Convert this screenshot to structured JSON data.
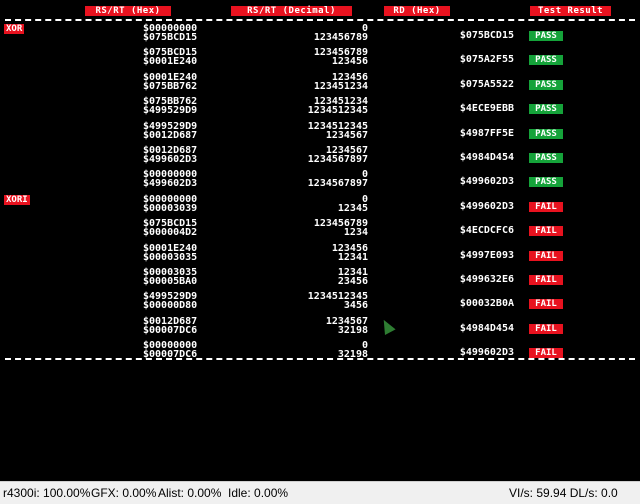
{
  "headers": {
    "rs_rt_hex": "RS/RT (Hex)",
    "rs_rt_dec": "RS/RT (Decimal)",
    "rd_hex": "RD (Hex)",
    "result": "Test Result"
  },
  "sections": [
    {
      "name": "XOR",
      "rows": [
        {
          "hex1": "$00000000",
          "hex2": "$075BCD15",
          "dec1": "0",
          "dec2": "123456789",
          "rd": "$075BCD15",
          "result": "PASS"
        },
        {
          "hex1": "$075BCD15",
          "hex2": "$0001E240",
          "dec1": "123456789",
          "dec2": "123456",
          "rd": "$075A2F55",
          "result": "PASS"
        },
        {
          "hex1": "$0001E240",
          "hex2": "$075BB762",
          "dec1": "123456",
          "dec2": "123451234",
          "rd": "$075A5522",
          "result": "PASS"
        },
        {
          "hex1": "$075BB762",
          "hex2": "$499529D9",
          "dec1": "123451234",
          "dec2": "1234512345",
          "rd": "$4ECE9EBB",
          "result": "PASS"
        },
        {
          "hex1": "$499529D9",
          "hex2": "$0012D687",
          "dec1": "1234512345",
          "dec2": "1234567",
          "rd": "$4987FF5E",
          "result": "PASS"
        },
        {
          "hex1": "$0012D687",
          "hex2": "$499602D3",
          "dec1": "1234567",
          "dec2": "1234567897",
          "rd": "$4984D454",
          "result": "PASS"
        },
        {
          "hex1": "$00000000",
          "hex2": "$499602D3",
          "dec1": "0",
          "dec2": "1234567897",
          "rd": "$499602D3",
          "result": "PASS"
        }
      ]
    },
    {
      "name": "XORI",
      "rows": [
        {
          "hex1": "$00000000",
          "hex2": "$00003039",
          "dec1": "0",
          "dec2": "12345",
          "rd": "$499602D3",
          "result": "FAIL"
        },
        {
          "hex1": "$075BCD15",
          "hex2": "$000004D2",
          "dec1": "123456789",
          "dec2": "1234",
          "rd": "$4ECDCFC6",
          "result": "FAIL"
        },
        {
          "hex1": "$0001E240",
          "hex2": "$00003035",
          "dec1": "123456",
          "dec2": "12341",
          "rd": "$4997E093",
          "result": "FAIL"
        },
        {
          "hex1": "$00003035",
          "hex2": "$00005BA0",
          "dec1": "12341",
          "dec2": "23456",
          "rd": "$499632E6",
          "result": "FAIL"
        },
        {
          "hex1": "$499529D9",
          "hex2": "$00000D80",
          "dec1": "1234512345",
          "dec2": "3456",
          "rd": "$00032B0A",
          "result": "FAIL"
        },
        {
          "hex1": "$0012D687",
          "hex2": "$00007DC6",
          "dec1": "1234567",
          "dec2": "32198",
          "rd": "$4984D454",
          "result": "FAIL"
        },
        {
          "hex1": "$00000000",
          "hex2": "$00007DC6",
          "dec1": "0",
          "dec2": "32198",
          "rd": "$499602D3",
          "result": "FAIL"
        }
      ]
    }
  ],
  "colors": {
    "header_bg": "#e8121f",
    "pass_bg": "#15a33a",
    "fail_bg": "#e8121f",
    "screen_bg": "#000000"
  },
  "status": {
    "rsp": "r4300i: 100.00%",
    "gfx": "GFX: 0.00%",
    "alist": "Alist: 0.00%",
    "idle": "Idle: 0.00%",
    "rates": "VI/s: 59.94 DL/s: 0.0"
  }
}
